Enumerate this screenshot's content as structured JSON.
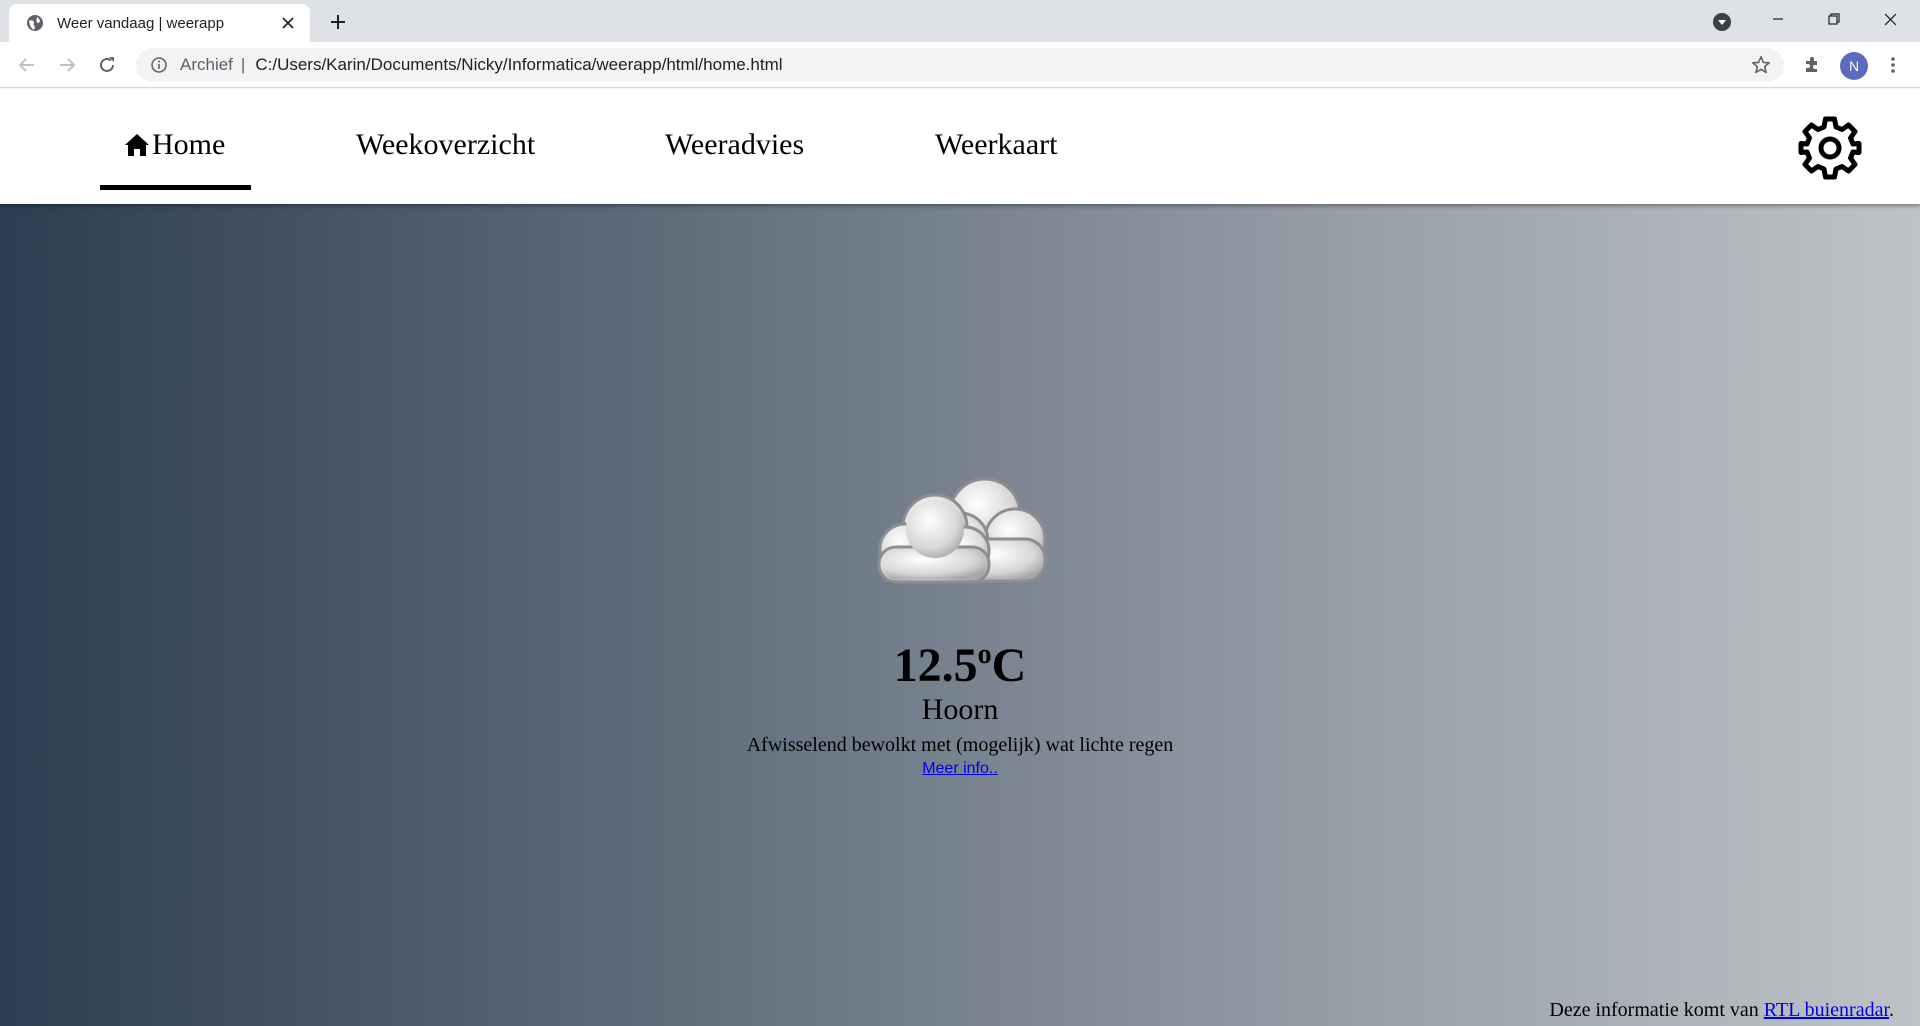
{
  "browser": {
    "tab_title": "Weer vandaag | weerapp",
    "address_prefix": "Archief",
    "address_separator": "|",
    "url": "C:/Users/Karin/Documents/Nicky/Informatica/weerapp/html/home.html",
    "profile_initial": "N",
    "accent_color": "#5c6bc0"
  },
  "nav": {
    "items": [
      {
        "label": "Home",
        "active": true,
        "icon": "home-icon"
      },
      {
        "label": "Weekoverzicht"
      },
      {
        "label": "Weeradvies"
      },
      {
        "label": "Weerkaart"
      }
    ],
    "settings_icon": "gear-icon"
  },
  "weather": {
    "icon": "cloud-icon",
    "temperature": "12.5",
    "degree": "o",
    "unit": "C",
    "city": "Hoorn",
    "description": "Afwisselend bewolkt met (mogelijk) wat lichte regen",
    "more_link": "Meer info.."
  },
  "footer": {
    "credit_prefix": "Deze informatie komt van ",
    "credit_link": "RTL buienradar",
    "credit_suffix": "."
  },
  "colors": {
    "gradient_start": "#2d3e50",
    "gradient_end": "#bfc3c7",
    "link": "#0000ee"
  }
}
